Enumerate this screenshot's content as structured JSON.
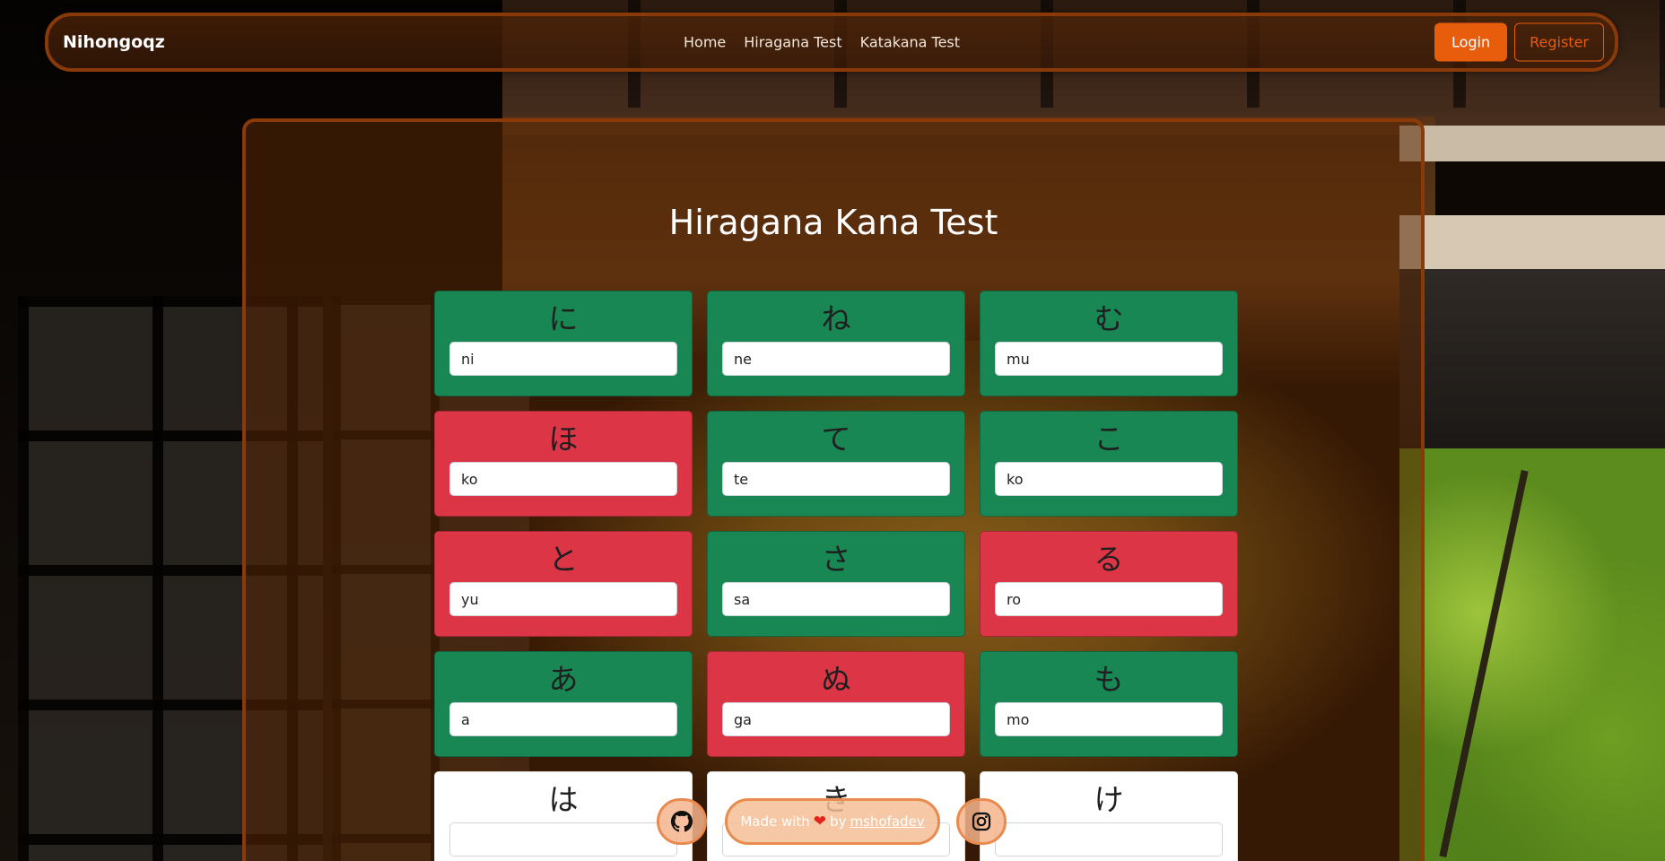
{
  "navbar": {
    "brand": "Nihongoqz",
    "links": [
      {
        "label": "Home"
      },
      {
        "label": "Hiragana Test"
      },
      {
        "label": "Katakana Test"
      }
    ],
    "login_label": "Login",
    "register_label": "Register"
  },
  "main": {
    "title": "Hiragana Kana Test",
    "cards": [
      {
        "kana": "に",
        "answer": "ni",
        "status": "correct"
      },
      {
        "kana": "ね",
        "answer": "ne",
        "status": "correct"
      },
      {
        "kana": "む",
        "answer": "mu",
        "status": "correct"
      },
      {
        "kana": "ほ",
        "answer": "ko",
        "status": "wrong"
      },
      {
        "kana": "て",
        "answer": "te",
        "status": "correct"
      },
      {
        "kana": "こ",
        "answer": "ko",
        "status": "correct"
      },
      {
        "kana": "と",
        "answer": "yu",
        "status": "wrong"
      },
      {
        "kana": "さ",
        "answer": "sa",
        "status": "correct"
      },
      {
        "kana": "る",
        "answer": "ro",
        "status": "wrong"
      },
      {
        "kana": "あ",
        "answer": "a",
        "status": "correct"
      },
      {
        "kana": "ぬ",
        "answer": "ga",
        "status": "wrong"
      },
      {
        "kana": "も",
        "answer": "mo",
        "status": "correct"
      },
      {
        "kana": "は",
        "answer": "",
        "status": "blank"
      },
      {
        "kana": "き",
        "answer": "",
        "status": "blank"
      },
      {
        "kana": "け",
        "answer": "",
        "status": "blank"
      }
    ]
  },
  "footer": {
    "made_with": "Made with",
    "by": "by",
    "author": "mshofadev",
    "github_icon": "github-icon",
    "instagram_icon": "instagram-icon"
  },
  "colors": {
    "accent": "#e85d0c",
    "correct": "#198754",
    "wrong": "#dc3545",
    "border": "#8a3a08"
  }
}
